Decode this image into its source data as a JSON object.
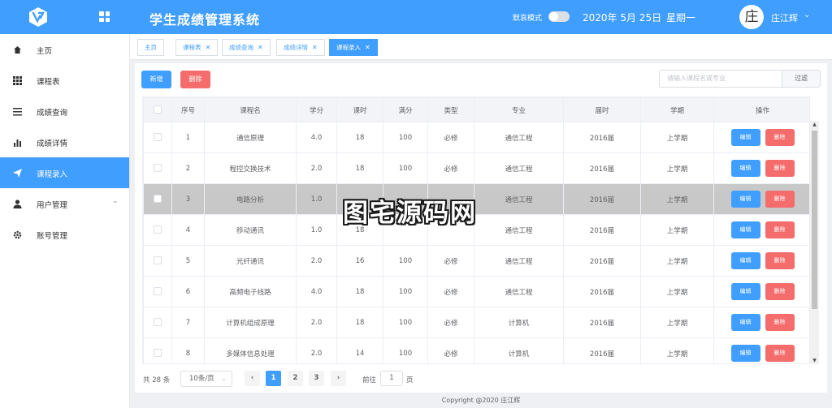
{
  "header": {
    "title": "学生成绩管理系统",
    "dark_mode_label": "默哀模式",
    "date": "2020年 5月 25日",
    "weekday": "星期一",
    "avatar_char": "庄",
    "username": "庄江辉",
    "dark_mode_on": false
  },
  "sidebar": {
    "items": [
      {
        "label": "主页",
        "icon": "home-icon"
      },
      {
        "label": "课程表",
        "icon": "grid-icon"
      },
      {
        "label": "成绩查询",
        "icon": "list-icon"
      },
      {
        "label": "成绩详情",
        "icon": "bar-chart-icon"
      },
      {
        "label": "课程录入",
        "icon": "send-icon",
        "active": true
      },
      {
        "label": "用户管理",
        "icon": "user-icon",
        "expandable": true
      },
      {
        "label": "账号管理",
        "icon": "gear-icon"
      }
    ]
  },
  "tabs": [
    {
      "label": "主页",
      "closable": false
    },
    {
      "label": "课程表",
      "closable": true
    },
    {
      "label": "成绩查询",
      "closable": true
    },
    {
      "label": "成绩详情",
      "closable": true
    },
    {
      "label": "课程录入",
      "closable": true,
      "active": true
    }
  ],
  "toolbar": {
    "add_label": "新增",
    "delete_label": "删除",
    "search_placeholder": "请输入课程名或专业",
    "filter_label": "过滤"
  },
  "table": {
    "columns": [
      "序号",
      "课程名",
      "学分",
      "课时",
      "满分",
      "类型",
      "专业",
      "届时",
      "学期",
      "操作"
    ],
    "rows": [
      [
        "1",
        "通信原理",
        "4.0",
        "18",
        "100",
        "必修",
        "通信工程",
        "2016届",
        "上学期"
      ],
      [
        "2",
        "程控交换技术",
        "2.0",
        "18",
        "100",
        "必修",
        "通信工程",
        "2016届",
        "上学期"
      ],
      [
        "3",
        "电路分析",
        "1.0",
        "",
        "",
        "",
        "通信工程",
        "2016届",
        "上学期"
      ],
      [
        "4",
        "移动通讯",
        "1.0",
        "18",
        "",
        "",
        "通信工程",
        "2016届",
        "上学期"
      ],
      [
        "5",
        "光纤通讯",
        "2.0",
        "16",
        "100",
        "必修",
        "通信工程",
        "2016届",
        "上学期"
      ],
      [
        "6",
        "高频电子线路",
        "4.0",
        "18",
        "100",
        "必修",
        "通信工程",
        "2016届",
        "上学期"
      ],
      [
        "7",
        "计算机组成原理",
        "2.0",
        "18",
        "100",
        "必修",
        "计算机",
        "2016届",
        "上学期"
      ],
      [
        "8",
        "多媒体信息处理",
        "2.0",
        "14",
        "100",
        "必修",
        "计算机",
        "2016届",
        "上学期"
      ]
    ],
    "highlighted_row": 2,
    "edit_label": "编辑",
    "delete_label": "删除"
  },
  "pagination": {
    "total_text": "共 28 条",
    "page_size": "10条/页",
    "pages": [
      "1",
      "2",
      "3"
    ],
    "current_page": "1",
    "goto_label": "前往",
    "goto_value": "1",
    "goto_unit": "页"
  },
  "footer": "Copyright @2020 庄江辉",
  "watermark": "图宅源码网",
  "colors": {
    "primary": "#409eff",
    "danger": "#f56c6c",
    "highlight_row": "#c8c8c8"
  }
}
